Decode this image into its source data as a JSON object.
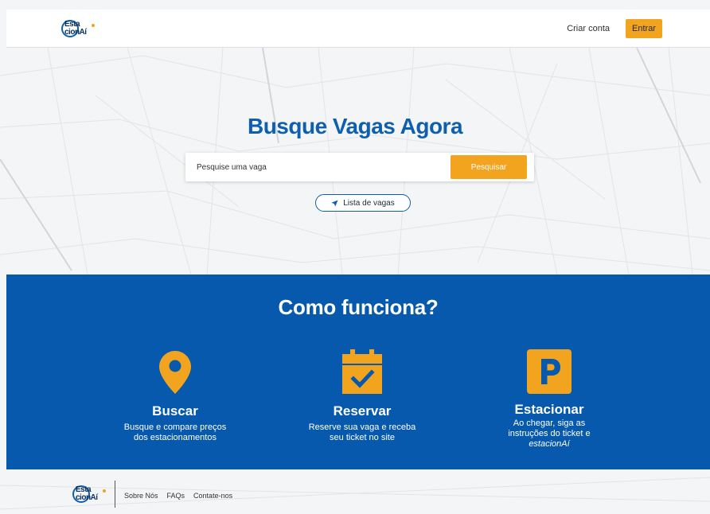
{
  "header": {
    "logo_line1": "Esta",
    "logo_line2": "cionAí",
    "create_account": "Criar conta",
    "login": "Entrar"
  },
  "hero": {
    "title": "Busque Vagas Agora",
    "search_placeholder": "Pesquise uma vaga",
    "search_button": "Pesquisar",
    "list_button": "Lista de vagas"
  },
  "how": {
    "title": "Como funciona?",
    "steps": [
      {
        "icon": "map-pin-icon",
        "title": "Buscar",
        "line1": "Busque e compare preços",
        "line2": "dos estacionamentos"
      },
      {
        "icon": "calendar-check-icon",
        "title": "Reservar",
        "line1": "Reserve sua vaga e receba",
        "line2": "seu ticket no site"
      },
      {
        "icon": "parking-icon",
        "title": "Estacionar",
        "line1": "Ao chegar, siga as",
        "line2": "instruções do ticket e",
        "line3": "estacionAí"
      }
    ]
  },
  "footer": {
    "logo_line1": "Esta",
    "logo_line2": "cionAí",
    "links": [
      "Sobre Nós",
      "FAQs",
      "Contate-nos"
    ]
  },
  "colors": {
    "primary": "#0659ad",
    "accent": "#f2a41f",
    "background": "#f4f5f6"
  }
}
